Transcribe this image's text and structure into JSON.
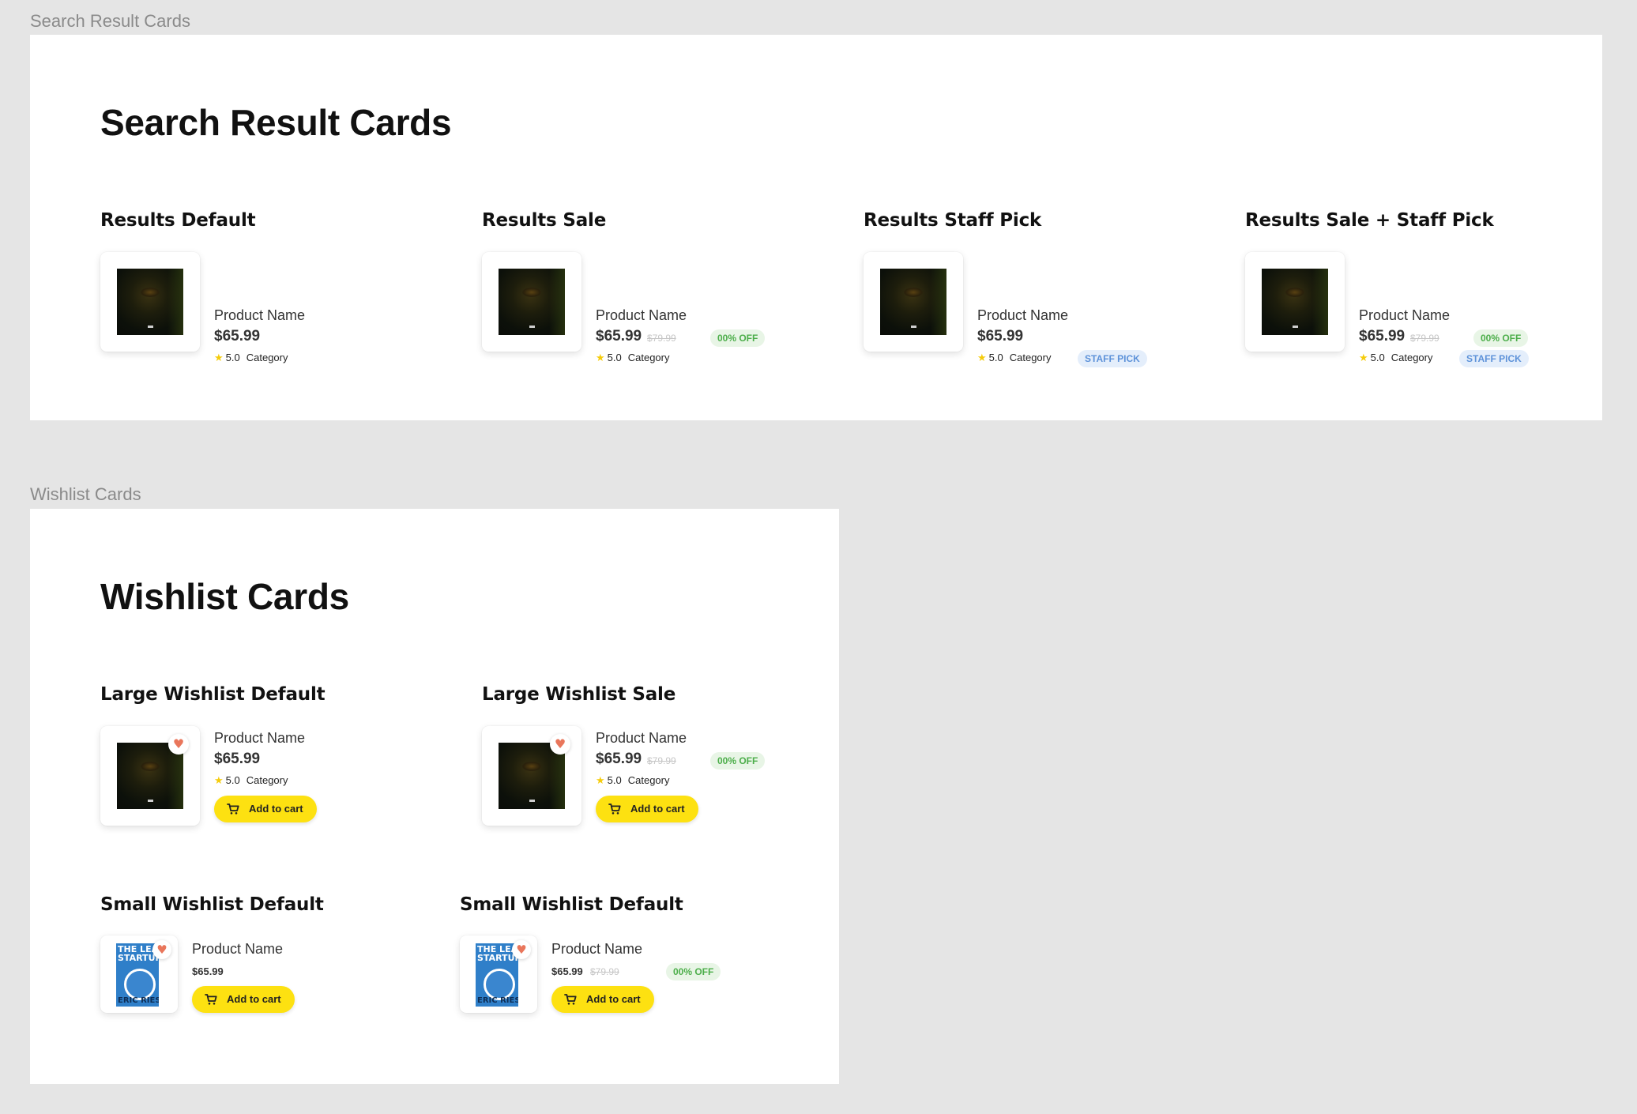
{
  "frames": {
    "search_label": "Search Result Cards",
    "search_title": "Search Result Cards",
    "wishlist_label": "Wishlist Cards",
    "wishlist_title": "Wishlist Cards"
  },
  "sections": {
    "results_default": "Results Default",
    "results_sale": "Results Sale",
    "results_staff_pick": "Results Staff Pick",
    "results_sale_staff_pick": "Results Sale + Staff Pick",
    "large_wishlist_default": "Large Wishlist Default",
    "large_wishlist_sale": "Large Wishlist Sale",
    "small_wishlist_default_1": "Small Wishlist Default",
    "small_wishlist_default_2": "Small Wishlist Default"
  },
  "product": {
    "name": "Product Name",
    "price": "$65.99",
    "old_price": "$79.99",
    "rating": "5.0",
    "category": "Category"
  },
  "badges": {
    "sale": "00% OFF",
    "staff_pick": "STAFF PICK"
  },
  "book_cover": {
    "title_line1": "THE LEAN",
    "title_line2": "STARTUP",
    "author": "ERIC RIES"
  },
  "buttons": {
    "add_to_cart": "Add to cart"
  },
  "icons": {
    "star": "star-icon",
    "heart": "heart-icon",
    "cart": "cart-icon"
  },
  "colors": {
    "canvas": "#e5e5e5",
    "frame": "#ffffff",
    "accent_yellow": "#fde111",
    "sale_green": "#4cae4a",
    "sale_bg": "#e8f5e6",
    "staff_blue": "#5d92d9",
    "staff_bg": "#e4eefb",
    "heart": "#e9765b",
    "star": "#f5cc0c"
  }
}
